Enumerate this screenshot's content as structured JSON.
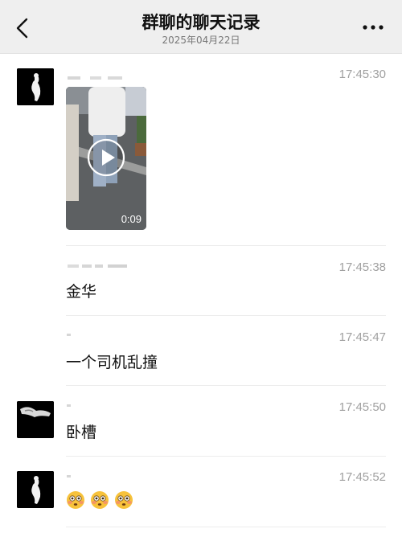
{
  "header": {
    "title": "群聊的聊天记录",
    "date": "2025年04月22日"
  },
  "messages": [
    {
      "type": "video",
      "time": "17:45:30",
      "duration": "0:09"
    },
    {
      "type": "text",
      "time": "17:45:38",
      "text": "金华"
    },
    {
      "type": "text",
      "time": "17:45:47",
      "text": "一个司机乱撞"
    },
    {
      "type": "text",
      "time": "17:45:50",
      "text": "卧槽"
    },
    {
      "type": "emoji",
      "time": "17:45:52",
      "emojis": [
        "flushed-face-icon",
        "flushed-face-icon",
        "flushed-face-icon"
      ]
    }
  ],
  "colors": {
    "header_bg": "#efefef",
    "timestamp": "#a0a0a0",
    "divider": "#ececec"
  }
}
